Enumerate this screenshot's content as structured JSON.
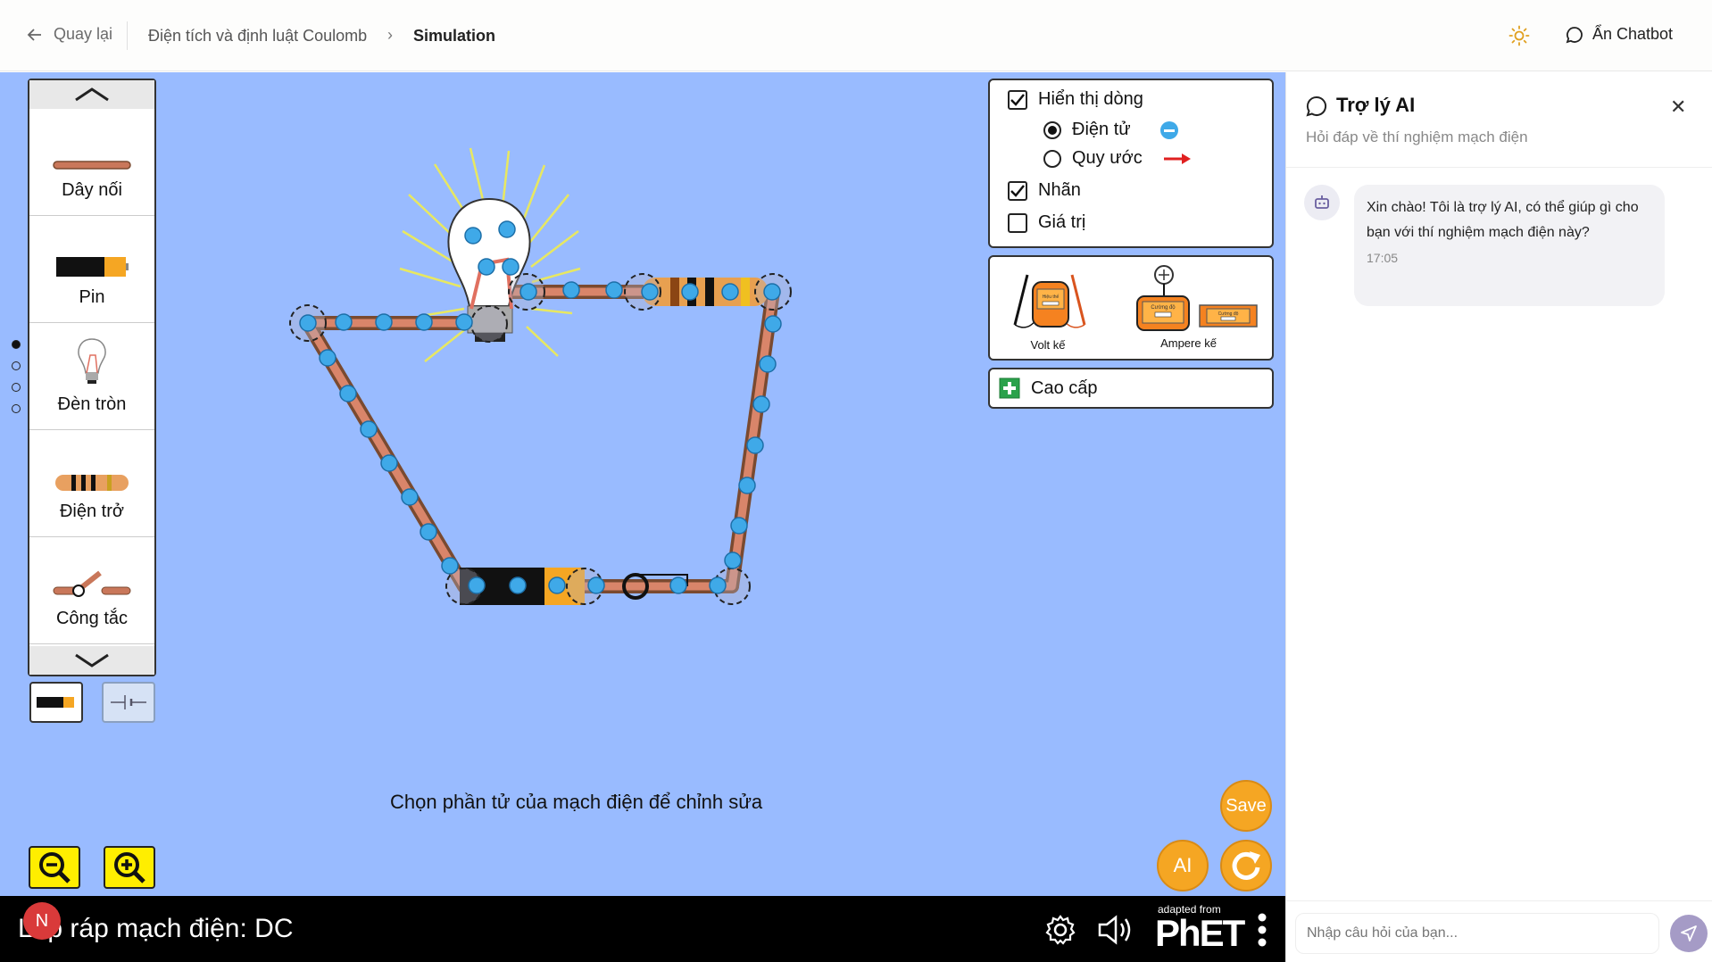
{
  "topbar": {
    "back_label": "Quay lại",
    "breadcrumb_lesson": "Điện tích và định luật Coulomb",
    "breadcrumb_current": "Simulation",
    "hide_chat_label": "Ẩn Chatbot"
  },
  "toolbox": {
    "items": [
      {
        "label": "Dây nối",
        "icon": "wire-icon"
      },
      {
        "label": "Pin",
        "icon": "battery-icon"
      },
      {
        "label": "Đèn tròn",
        "icon": "bulb-icon"
      },
      {
        "label": "Điện trở",
        "icon": "resistor-icon"
      },
      {
        "label": "Công tắc",
        "icon": "switch-icon"
      }
    ]
  },
  "view_panel": {
    "show_current_label": "Hiển thị dòng",
    "show_current_checked": true,
    "electron_label": "Điện tử",
    "conventional_label": "Quy ước",
    "selected": "electron",
    "labels_label": "Nhãn",
    "labels_checked": true,
    "values_label": "Giá trị",
    "values_checked": false
  },
  "meters_panel": {
    "voltmeter_label": "Volt kế",
    "ammeter_label": "Ampere kế",
    "meter_screen_text": "Hiệu thế",
    "ammeter_screen_text": "Cường độ"
  },
  "advanced_label": "Cao cấp",
  "hint": "Chọn phần tử của mạch điện để chỉnh sửa",
  "buttons": {
    "save": "Save",
    "ai": "AI"
  },
  "phet": {
    "sim_title": "Lắp ráp mạch điện: DC",
    "adapted_from": "adapted from",
    "brand": "PhET",
    "badge": "N"
  },
  "ai_panel": {
    "title": "Trợ lý AI",
    "subtitle": "Hỏi đáp về thí nghiệm mạch điện",
    "message": "Xin chào! Tôi là trợ lý AI, có thể giúp gì cho bạn với thí nghiệm mạch điện này?",
    "time": "17:05",
    "input_placeholder": "Nhập câu hỏi của bạn..."
  },
  "colors": {
    "sim_bg": "#99bbff",
    "accent_orange": "#f5a623",
    "zoom_yellow": "#ffee00",
    "electron": "#3fa9e8"
  }
}
